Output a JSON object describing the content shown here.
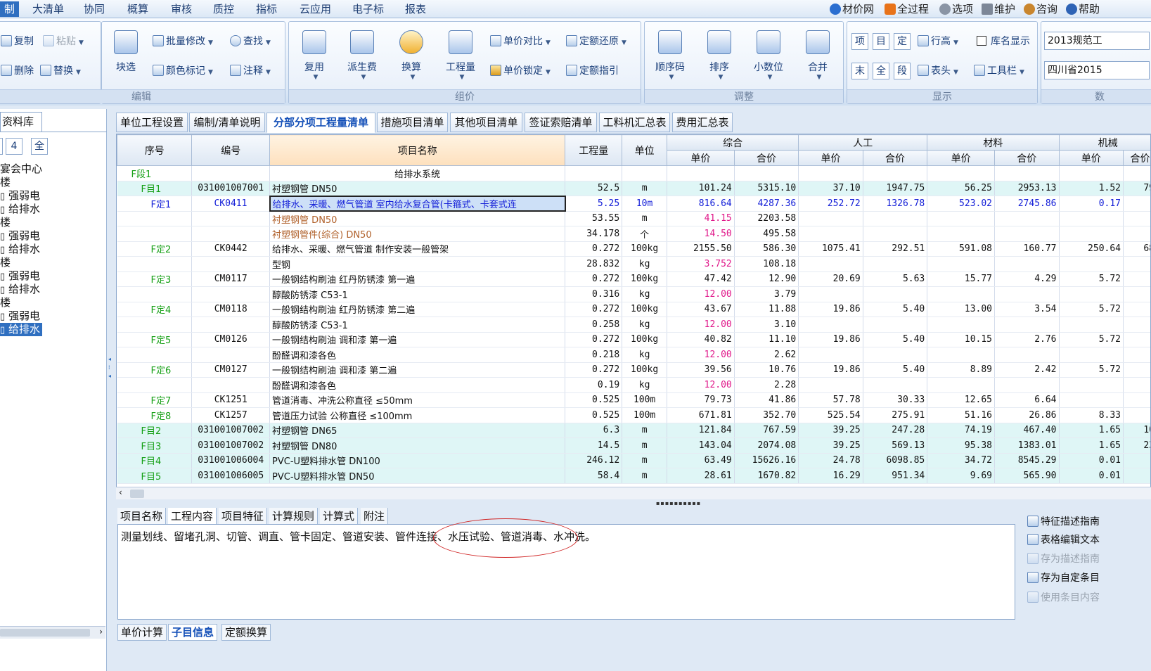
{
  "menu": {
    "items": [
      "制",
      "大清单",
      "协同",
      "概算",
      "审核",
      "质控",
      "指标",
      "云应用",
      "电子标",
      "报表"
    ],
    "right": [
      "材价网",
      "全过程",
      "选项",
      "维护",
      "咨询",
      "帮助"
    ]
  },
  "ribbon": {
    "edit": {
      "label": "编辑",
      "copy": "复制",
      "paste": "粘贴",
      "delete": "删除",
      "replace": "替换",
      "select": "块选",
      "batch": "批量修改",
      "find": "查找",
      "color": "颜色标记",
      "note": "注释"
    },
    "price": {
      "label": "组价",
      "reuse": "复用",
      "fee": "派生费",
      "convert": "换算",
      "qty": "工程量",
      "compare": "单价对比",
      "restore": "定额还原",
      "lock": "单价锁定",
      "guide": "定额指引"
    },
    "adjust": {
      "label": "调整",
      "order": "顺序码",
      "sort": "排序",
      "decimal": "小数位",
      "merge": "合并"
    },
    "display": {
      "label": "显示",
      "b1": "项",
      "b2": "目",
      "b3": "定",
      "b4": "末",
      "b5": "全",
      "b6": "段",
      "rowh": "行高",
      "libname": "库名显示",
      "header": "表头",
      "toolbar": "工具栏"
    },
    "combos": [
      "2013规范工",
      "四川省2015"
    ],
    "data_label": "数"
  },
  "left": {
    "tab": "资料库",
    "btn_4": "4",
    "btn_all": "全",
    "tree": [
      "宴会中心",
      "楼",
      "强弱电",
      "给排水",
      "楼",
      "强弱电",
      "给排水",
      "楼",
      "强弱电",
      "给排水",
      "楼",
      "强弱电",
      "给排水"
    ]
  },
  "tabs": [
    "单位工程设置",
    "编制/清单说明",
    "分部分项工程量清单",
    "措施项目清单",
    "其他项目清单",
    "签证索赔清单",
    "工料机汇总表",
    "费用汇总表"
  ],
  "grid": {
    "headers": {
      "seq": "序号",
      "code": "编号",
      "name": "项目名称",
      "qty": "工程量",
      "unit": "单位",
      "total": "综合",
      "labor": "人工",
      "material": "材料",
      "machine": "机械",
      "price": "单价",
      "sum": "合价"
    },
    "rows": [
      {
        "seq": "F段1",
        "code": "",
        "name": "给排水系统",
        "qty": "",
        "unit": "",
        "tp": "",
        "ts": "",
        "lp": "",
        "ls": "",
        "mp": "",
        "ms": "",
        "kp": "",
        "ks": ""
      },
      {
        "seq": "F目1",
        "code": "031001007001",
        "name": "衬塑钢管 DN50",
        "qty": "52.5",
        "unit": "m",
        "tp": "101.24",
        "ts": "5315.10",
        "lp": "37.10",
        "ls": "1947.75",
        "mp": "56.25",
        "ms": "2953.13",
        "kp": "1.52",
        "ks": "79"
      },
      {
        "seq": "F定1",
        "code": "CK0411",
        "name": "给排水、采暖、燃气管道 室内给水复合管(卡箍式、卡套式连",
        "qty": "5.25",
        "unit": "10m",
        "tp": "816.64",
        "ts": "4287.36",
        "lp": "252.72",
        "ls": "1326.78",
        "mp": "523.02",
        "ms": "2745.86",
        "kp": "0.17",
        "ks": ""
      },
      {
        "seq": "",
        "code": "",
        "name": "衬塑钢管 DN50",
        "qty": "53.55",
        "unit": "m",
        "tp": "41.15",
        "ts": "2203.58",
        "lp": "",
        "ls": "",
        "mp": "",
        "ms": "",
        "kp": "",
        "ks": ""
      },
      {
        "seq": "",
        "code": "",
        "name": "衬塑钢管件(综合) DN50",
        "qty": "34.178",
        "unit": "个",
        "tp": "14.50",
        "ts": "495.58",
        "lp": "",
        "ls": "",
        "mp": "",
        "ms": "",
        "kp": "",
        "ks": ""
      },
      {
        "seq": "F定2",
        "code": "CK0442",
        "name": "给排水、采暖、燃气管道 制作安装一般管架",
        "qty": "0.272",
        "unit": "100kg",
        "tp": "2155.50",
        "ts": "586.30",
        "lp": "1075.41",
        "ls": "292.51",
        "mp": "591.08",
        "ms": "160.77",
        "kp": "250.64",
        "ks": "68"
      },
      {
        "seq": "",
        "code": "",
        "name": "型钢",
        "qty": "28.832",
        "unit": "kg",
        "tp": "3.752",
        "ts": "108.18",
        "lp": "",
        "ls": "",
        "mp": "",
        "ms": "",
        "kp": "",
        "ks": ""
      },
      {
        "seq": "F定3",
        "code": "CM0117",
        "name": "一般钢结构刷油 红丹防锈漆 第一遍",
        "qty": "0.272",
        "unit": "100kg",
        "tp": "47.42",
        "ts": "12.90",
        "lp": "20.69",
        "ls": "5.63",
        "mp": "15.77",
        "ms": "4.29",
        "kp": "5.72",
        "ks": ""
      },
      {
        "seq": "",
        "code": "",
        "name": "醇酸防锈漆 C53-1",
        "qty": "0.316",
        "unit": "kg",
        "tp": "12.00",
        "ts": "3.79",
        "lp": "",
        "ls": "",
        "mp": "",
        "ms": "",
        "kp": "",
        "ks": ""
      },
      {
        "seq": "F定4",
        "code": "CM0118",
        "name": "一般钢结构刷油 红丹防锈漆 第二遍",
        "qty": "0.272",
        "unit": "100kg",
        "tp": "43.67",
        "ts": "11.88",
        "lp": "19.86",
        "ls": "5.40",
        "mp": "13.00",
        "ms": "3.54",
        "kp": "5.72",
        "ks": ""
      },
      {
        "seq": "",
        "code": "",
        "name": "醇酸防锈漆 C53-1",
        "qty": "0.258",
        "unit": "kg",
        "tp": "12.00",
        "ts": "3.10",
        "lp": "",
        "ls": "",
        "mp": "",
        "ms": "",
        "kp": "",
        "ks": ""
      },
      {
        "seq": "F定5",
        "code": "CM0126",
        "name": "一般钢结构刷油 调和漆  第一遍",
        "qty": "0.272",
        "unit": "100kg",
        "tp": "40.82",
        "ts": "11.10",
        "lp": "19.86",
        "ls": "5.40",
        "mp": "10.15",
        "ms": "2.76",
        "kp": "5.72",
        "ks": ""
      },
      {
        "seq": "",
        "code": "",
        "name": "酚醛调和漆各色",
        "qty": "0.218",
        "unit": "kg",
        "tp": "12.00",
        "ts": "2.62",
        "lp": "",
        "ls": "",
        "mp": "",
        "ms": "",
        "kp": "",
        "ks": ""
      },
      {
        "seq": "F定6",
        "code": "CM0127",
        "name": "一般钢结构刷油 调和漆  第二遍",
        "qty": "0.272",
        "unit": "100kg",
        "tp": "39.56",
        "ts": "10.76",
        "lp": "19.86",
        "ls": "5.40",
        "mp": "8.89",
        "ms": "2.42",
        "kp": "5.72",
        "ks": ""
      },
      {
        "seq": "",
        "code": "",
        "name": "酚醛调和漆各色",
        "qty": "0.19",
        "unit": "kg",
        "tp": "12.00",
        "ts": "2.28",
        "lp": "",
        "ls": "",
        "mp": "",
        "ms": "",
        "kp": "",
        "ks": ""
      },
      {
        "seq": "F定7",
        "code": "CK1251",
        "name": "管道消毒、冲洗公称直径 ≤50mm",
        "qty": "0.525",
        "unit": "100m",
        "tp": "79.73",
        "ts": "41.86",
        "lp": "57.78",
        "ls": "30.33",
        "mp": "12.65",
        "ms": "6.64",
        "kp": "",
        "ks": ""
      },
      {
        "seq": "F定8",
        "code": "CK1257",
        "name": "管道压力试验 公称直径 ≤100mm",
        "qty": "0.525",
        "unit": "100m",
        "tp": "671.81",
        "ts": "352.70",
        "lp": "525.54",
        "ls": "275.91",
        "mp": "51.16",
        "ms": "26.86",
        "kp": "8.33",
        "ks": ""
      },
      {
        "seq": "F目2",
        "code": "031001007002",
        "name": "衬塑钢管 DN65",
        "qty": "6.3",
        "unit": "m",
        "tp": "121.84",
        "ts": "767.59",
        "lp": "39.25",
        "ls": "247.28",
        "mp": "74.19",
        "ms": "467.40",
        "kp": "1.65",
        "ks": "10"
      },
      {
        "seq": "F目3",
        "code": "031001007002",
        "name": "衬塑钢管 DN80",
        "qty": "14.5",
        "unit": "m",
        "tp": "143.04",
        "ts": "2074.08",
        "lp": "39.25",
        "ls": "569.13",
        "mp": "95.38",
        "ms": "1383.01",
        "kp": "1.65",
        "ks": "23"
      },
      {
        "seq": "F目4",
        "code": "031001006004",
        "name": "PVC-U塑料排水管 DN100",
        "qty": "246.12",
        "unit": "m",
        "tp": "63.49",
        "ts": "15626.16",
        "lp": "24.78",
        "ls": "6098.85",
        "mp": "34.72",
        "ms": "8545.29",
        "kp": "0.01",
        "ks": ""
      },
      {
        "seq": "F目5",
        "code": "031001006005",
        "name": "PVC-U塑料排水管 DN50",
        "qty": "58.4",
        "unit": "m",
        "tp": "28.61",
        "ts": "1670.82",
        "lp": "16.29",
        "ls": "951.34",
        "mp": "9.69",
        "ms": "565.90",
        "kp": "0.01",
        "ks": ""
      }
    ]
  },
  "detail": {
    "tabs": [
      "项目名称",
      "工程内容",
      "项目特征",
      "计算规则",
      "计算式",
      "附注"
    ],
    "content": "测量划线、留堵孔洞、切管、调直、管卡固定、管道安装、管件连接、水压试验、管道消毒、水冲洗。",
    "side": [
      "特征描述指南",
      "表格编辑文本",
      "存为描述指南",
      "存为自定条目",
      "使用条目内容"
    ],
    "bottom_tabs": [
      "单价计算",
      "子目信息",
      "定额换算"
    ]
  }
}
